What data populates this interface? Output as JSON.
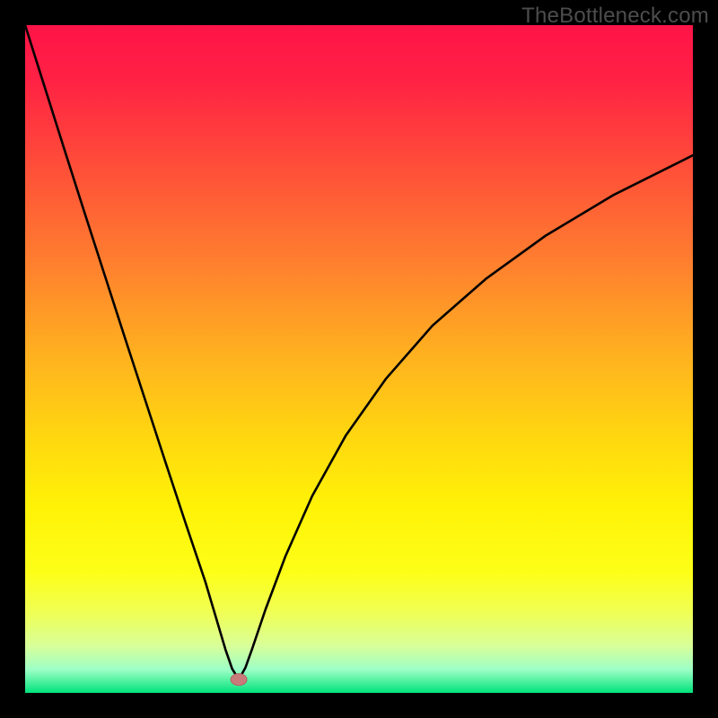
{
  "watermark": "TheBottleneck.com",
  "colors": {
    "black": "#000000",
    "curve": "#000000",
    "marker_fill": "#c97b7c",
    "marker_stroke": "#b26363",
    "gradient_stops": [
      {
        "offset": 0.0,
        "color": "#ff1448"
      },
      {
        "offset": 0.08,
        "color": "#ff2144"
      },
      {
        "offset": 0.2,
        "color": "#ff4a3a"
      },
      {
        "offset": 0.35,
        "color": "#ff7d2f"
      },
      {
        "offset": 0.5,
        "color": "#ffb31f"
      },
      {
        "offset": 0.62,
        "color": "#ffd80f"
      },
      {
        "offset": 0.72,
        "color": "#fff207"
      },
      {
        "offset": 0.82,
        "color": "#fdff18"
      },
      {
        "offset": 0.88,
        "color": "#f0ff55"
      },
      {
        "offset": 0.93,
        "color": "#d8ff9a"
      },
      {
        "offset": 0.965,
        "color": "#9dffc6"
      },
      {
        "offset": 1.0,
        "color": "#00e37b"
      }
    ]
  },
  "chart_data": {
    "type": "line",
    "title": "",
    "xlabel": "",
    "ylabel": "",
    "xlim": [
      0,
      100
    ],
    "ylim": [
      0,
      100
    ],
    "grid": false,
    "legend": false,
    "minimum_marker": {
      "x": 32,
      "y": 2
    },
    "series": [
      {
        "name": "curve",
        "x": [
          0,
          3,
          6,
          9,
          12,
          15,
          18,
          21,
          24,
          27,
          30,
          31,
          32,
          33,
          34,
          36,
          39,
          43,
          48,
          54,
          61,
          69,
          78,
          88,
          100
        ],
        "y": [
          100,
          90.5,
          81,
          71.6,
          62.3,
          53,
          43.8,
          34.6,
          25.5,
          16.6,
          6.5,
          3.6,
          2,
          3.8,
          6.6,
          12.5,
          20.5,
          29.5,
          38.5,
          47,
          55,
          62,
          68.5,
          74.5,
          80.5
        ]
      }
    ]
  }
}
